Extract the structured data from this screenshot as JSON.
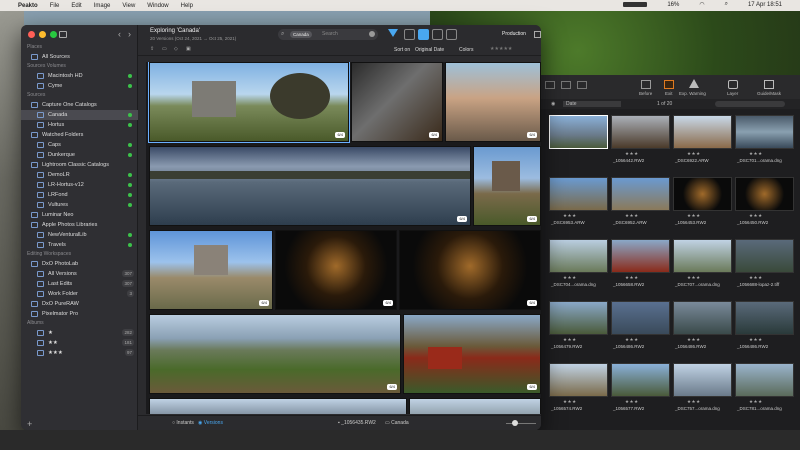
{
  "menubar": {
    "app": "Peakto",
    "items": [
      "File",
      "Edit",
      "Image",
      "View",
      "Window",
      "Help"
    ],
    "battery": "16%",
    "clock": "17 Apr 18:51"
  },
  "sidebar": {
    "sections": [
      {
        "label": "Places",
        "items": [
          {
            "label": "All Sources",
            "indent": 1
          }
        ]
      },
      {
        "label": "Sources Volumes",
        "items": [
          {
            "label": "Macintosh HD",
            "indent": 2,
            "dot": true
          },
          {
            "label": "Cyme",
            "indent": 2,
            "dot": true
          }
        ]
      },
      {
        "label": "Sources",
        "items": [
          {
            "label": "Capture One Catalogs",
            "indent": 1
          },
          {
            "label": "Canada",
            "indent": 2,
            "dot": true,
            "sel": true
          },
          {
            "label": "Hortus",
            "indent": 2,
            "dot": true
          },
          {
            "label": "Watched Folders",
            "indent": 1
          },
          {
            "label": "Caps",
            "indent": 2,
            "dot": true
          },
          {
            "label": "Dunkerque",
            "indent": 2,
            "dot": true
          },
          {
            "label": "Lightroom Classic Catalogs",
            "indent": 1
          },
          {
            "label": "DemoLR",
            "indent": 2,
            "dot": true
          },
          {
            "label": "LR-Hortus-v12",
            "indent": 2,
            "dot": true
          },
          {
            "label": "LRFond",
            "indent": 2,
            "dot": true
          },
          {
            "label": "Vultures",
            "indent": 2,
            "dot": true
          },
          {
            "label": "Luminar Neo",
            "indent": 1
          },
          {
            "label": "Apple Photos Libraries",
            "indent": 1
          },
          {
            "label": "NewVenturalLib",
            "indent": 2,
            "dot": true
          },
          {
            "label": "Travels",
            "indent": 2,
            "dot": true
          }
        ]
      },
      {
        "label": "Editing Workspaces",
        "items": [
          {
            "label": "DxO PhotoLab",
            "indent": 1
          },
          {
            "label": "All Versions",
            "indent": 2,
            "count": "307"
          },
          {
            "label": "Last Edits",
            "indent": 2,
            "count": "307"
          },
          {
            "label": "Work Folder",
            "indent": 2,
            "count": "3"
          },
          {
            "label": "DxO PureRAW",
            "indent": 1
          },
          {
            "label": "Pixelmator Pro",
            "indent": 1
          }
        ]
      },
      {
        "label": "Albums",
        "items": [
          {
            "label": "★",
            "indent": 2,
            "count": "282"
          },
          {
            "label": "★★",
            "indent": 2,
            "count": "181"
          },
          {
            "label": "★★★",
            "indent": 2,
            "count": "97"
          }
        ]
      }
    ]
  },
  "header": {
    "title": "Exploring 'Canada'",
    "subtitle": "20 Versions (Oct 24, 2021 → Oct 25, 2021)",
    "search_chip": "Canada",
    "search_placeholder": "Search",
    "workspace": "Production"
  },
  "toolbar": {
    "sort_label": "Sort on",
    "sort_value": "Original Date",
    "colors_label": "Colors",
    "rating": "★★★★★"
  },
  "tags": {
    "version": "6/4",
    "raw": "RAW"
  },
  "bottom": {
    "instants": "Instants",
    "versions": "Versions",
    "filename": "_1056435.RW2",
    "catalog": "Canada"
  },
  "c1": {
    "toolbar": [
      "Before",
      "Exit",
      "Exp. Warning",
      "Layer",
      "Guide/Mask"
    ],
    "sort": "Date",
    "page": "1 of 20",
    "thumbs": [
      {
        "name": "",
        "stars": ""
      },
      {
        "name": "_1056442.RW2",
        "stars": "★★★"
      },
      {
        "name": "_DSC6922.ARW",
        "stars": "★★★"
      },
      {
        "name": "_DSC701...orama.dng",
        "stars": "★★★"
      },
      {
        "name": "_DSC6953.ARW",
        "stars": "★★★"
      },
      {
        "name": "_DSC6952.ARW",
        "stars": "★★★"
      },
      {
        "name": "_1056453.RW2",
        "stars": "★★★"
      },
      {
        "name": "_1056450.RW2",
        "stars": "★★★"
      },
      {
        "name": "_DSC704...orama.dng",
        "stars": "★★★"
      },
      {
        "name": "_1056658.RW2",
        "stars": "★★★"
      },
      {
        "name": "_DSC707...orama.dng",
        "stars": "★★★"
      },
      {
        "name": "_1056688-lopaz-2.tiff",
        "stars": "★★★"
      },
      {
        "name": "_1056479.RW2",
        "stars": "★★★"
      },
      {
        "name": "_1056486.RW2",
        "stars": "★★★"
      },
      {
        "name": "_1056486.RW2",
        "stars": "★★★"
      },
      {
        "name": "_1056486.RW2",
        "stars": "★★★"
      },
      {
        "name": "_1056574.RW2",
        "stars": "★★★"
      },
      {
        "name": "_1056577.RW2",
        "stars": "★★★"
      },
      {
        "name": "_DSC757...orama.dng",
        "stars": "★★★"
      },
      {
        "name": "_DSC781...orama.dng",
        "stars": "★★★"
      }
    ]
  }
}
